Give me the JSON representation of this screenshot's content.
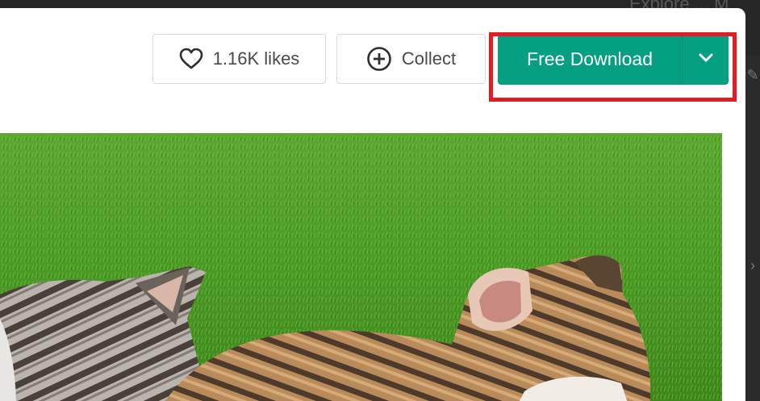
{
  "background": {
    "partial_text": "Explore ... M"
  },
  "actions": {
    "like_label": "1.16K likes",
    "collect_label": "Collect",
    "download_label": "Free Download"
  },
  "icons": {
    "like": "heart-icon",
    "collect": "plus-circle-icon",
    "dropdown": "chevron-down-icon"
  },
  "colors": {
    "download_button": "#05a081",
    "highlight_box": "#e31b23"
  }
}
